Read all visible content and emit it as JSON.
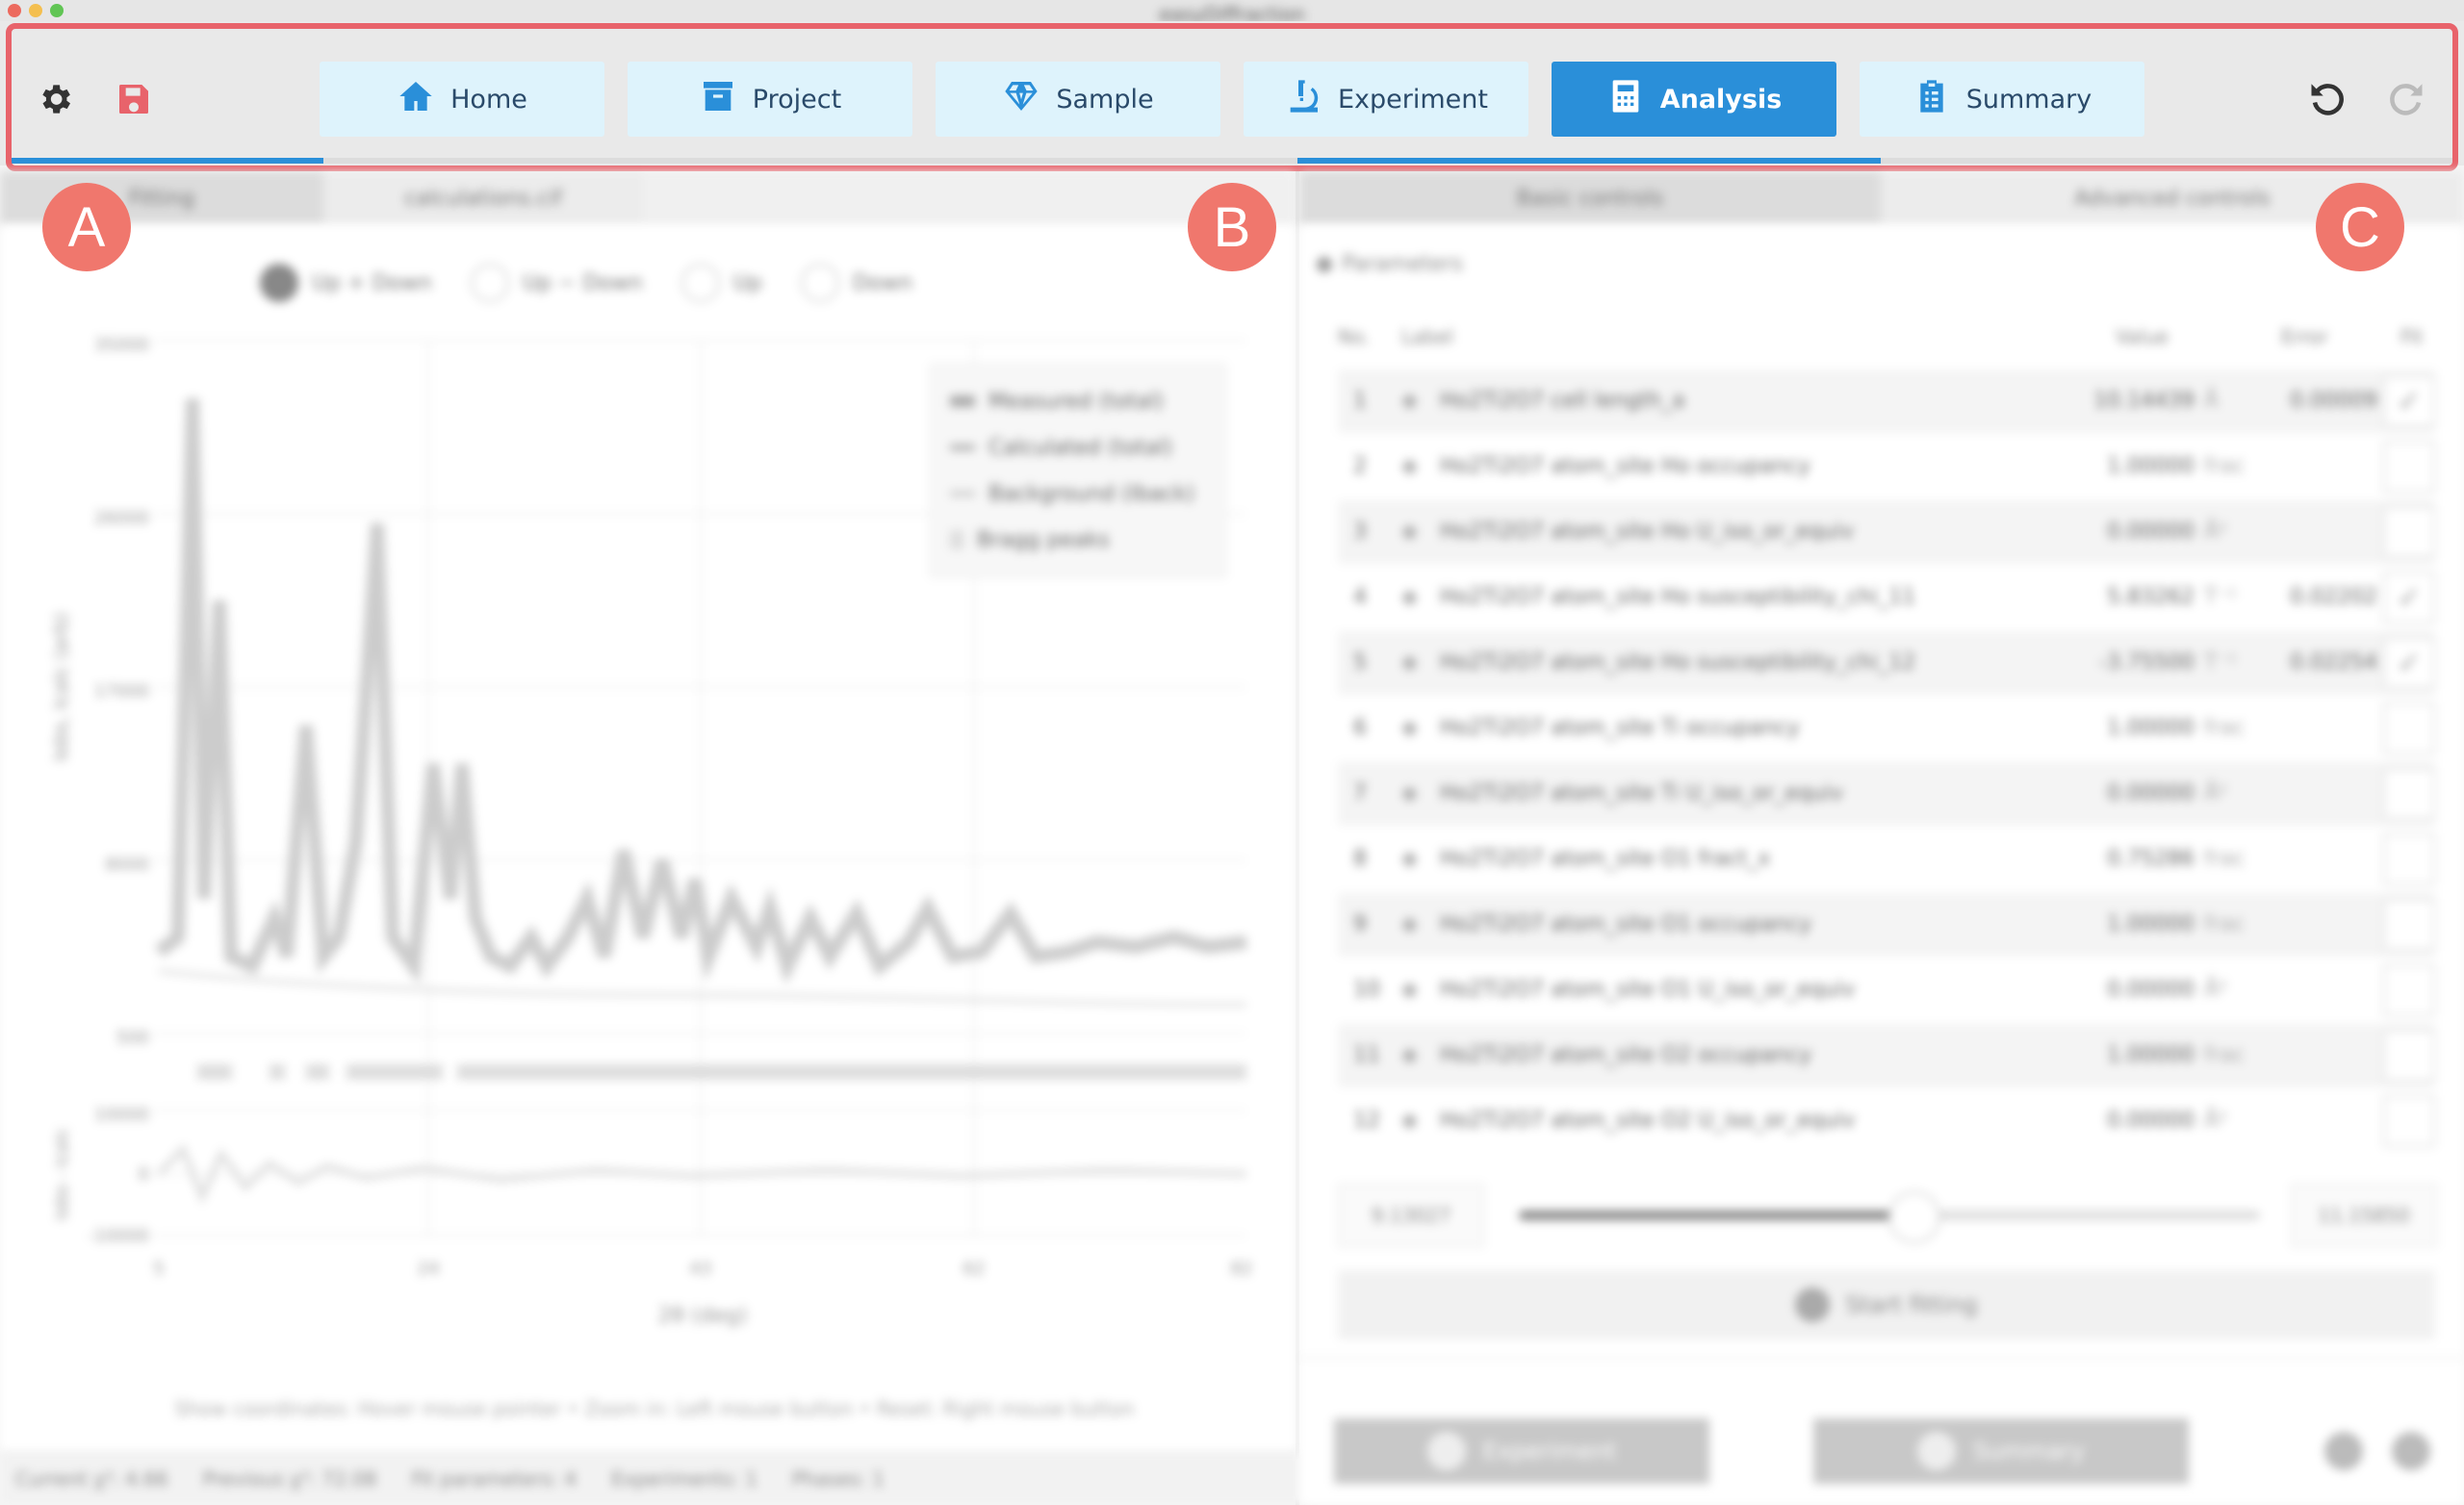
{
  "window": {
    "title": "easyDiffraction"
  },
  "toolbar": {
    "tabs": [
      {
        "label": "Home",
        "icon": "home-icon"
      },
      {
        "label": "Project",
        "icon": "archive-icon"
      },
      {
        "label": "Sample",
        "icon": "gem-icon"
      },
      {
        "label": "Experiment",
        "icon": "microscope-icon"
      },
      {
        "label": "Analysis",
        "icon": "calculator-icon",
        "active": true
      },
      {
        "label": "Summary",
        "icon": "clipboard-icon"
      }
    ],
    "left_icons": [
      "gear-icon",
      "save-icon"
    ],
    "right_icons": [
      "undo-icon",
      "redo-icon"
    ],
    "accent_color": "#2a8fd9",
    "save_color": "#e8636b"
  },
  "annotations": {
    "a": "A",
    "b": "B",
    "c": "C",
    "color": "#f0776d"
  },
  "left": {
    "subtabs": [
      "Fitting",
      "calculations.cif"
    ],
    "radios": [
      {
        "label": "Up + Down",
        "on": true
      },
      {
        "label": "Up − Down",
        "on": false
      },
      {
        "label": "Up",
        "on": false
      },
      {
        "label": "Down",
        "on": false
      }
    ],
    "legend": [
      "Measured (total)",
      "Calculated (total)",
      "Background (Iback)",
      "Bragg peaks"
    ],
    "y_ticks": [
      "35000",
      "26000",
      "17000",
      "8000",
      "500"
    ],
    "diff_ticks": [
      "10000",
      "0",
      "-10000"
    ],
    "x_ticks": [
      "5",
      "24",
      "43",
      "62",
      "82"
    ],
    "y_label": "Iobs, Icalc (arb)",
    "diff_label": "Iobs - Icalc",
    "x_label": "2θ (deg)",
    "hint": "Show coordinates: Hover mouse pointer  •  Zoom in: Left mouse button  •  Reset: Right mouse button",
    "status": [
      "Current χ²: 4.66",
      "Previous χ²: 72.08",
      "Fit parameters: 4",
      "Experiments: 1",
      "Phases: 1"
    ]
  },
  "right": {
    "subtabs": [
      "Basic controls",
      "Advanced controls"
    ],
    "section": "Parameters",
    "columns": {
      "no": "No.",
      "label": "Label",
      "value": "Value",
      "error": "Error",
      "fit": "Fit"
    },
    "rows": [
      {
        "no": "1",
        "label": "Ho2Ti2O7 cell length_a",
        "value": "10.14439",
        "unit": "Å",
        "error": "0.00009",
        "fit": true
      },
      {
        "no": "2",
        "label": "Ho2Ti2O7 atom_site Ho occupancy",
        "value": "1.00000",
        "unit": "frac",
        "error": "",
        "fit": false
      },
      {
        "no": "3",
        "label": "Ho2Ti2O7 atom_site Ho U_iso_or_equiv",
        "value": "0.00000",
        "unit": "Å²",
        "error": "",
        "fit": false
      },
      {
        "no": "4",
        "label": "Ho2Ti2O7 atom_site Ho susceptibility_chi_11",
        "value": "5.83262",
        "unit": "T⁻¹",
        "error": "0.02202",
        "fit": true
      },
      {
        "no": "5",
        "label": "Ho2Ti2O7 atom_site Ho susceptibility_chi_12",
        "value": "-3.75500",
        "unit": "T⁻¹",
        "error": "0.02254",
        "fit": true
      },
      {
        "no": "6",
        "label": "Ho2Ti2O7 atom_site Ti occupancy",
        "value": "1.00000",
        "unit": "frac",
        "error": "",
        "fit": false
      },
      {
        "no": "7",
        "label": "Ho2Ti2O7 atom_site Ti U_iso_or_equiv",
        "value": "0.00000",
        "unit": "Å²",
        "error": "",
        "fit": false
      },
      {
        "no": "8",
        "label": "Ho2Ti2O7 atom_site O1 fract_x",
        "value": "0.75286",
        "unit": "frac",
        "error": "",
        "fit": false
      },
      {
        "no": "9",
        "label": "Ho2Ti2O7 atom_site O1 occupancy",
        "value": "1.00000",
        "unit": "frac",
        "error": "",
        "fit": false
      },
      {
        "no": "10",
        "label": "Ho2Ti2O7 atom_site O1 U_iso_or_equiv",
        "value": "0.00000",
        "unit": "Å²",
        "error": "",
        "fit": false
      },
      {
        "no": "11",
        "label": "Ho2Ti2O7 atom_site O2 occupancy",
        "value": "1.00000",
        "unit": "frac",
        "error": "",
        "fit": false
      },
      {
        "no": "12",
        "label": "Ho2Ti2O7 atom_site O2 U_iso_or_equiv",
        "value": "0.00000",
        "unit": "Å²",
        "error": "",
        "fit": false
      }
    ],
    "slider": {
      "min": "9.13027",
      "max": "11.15850",
      "position": 0.52
    },
    "start_fitting": "Start fitting",
    "nav_prev": "Experiment",
    "nav_next": "Summary"
  }
}
